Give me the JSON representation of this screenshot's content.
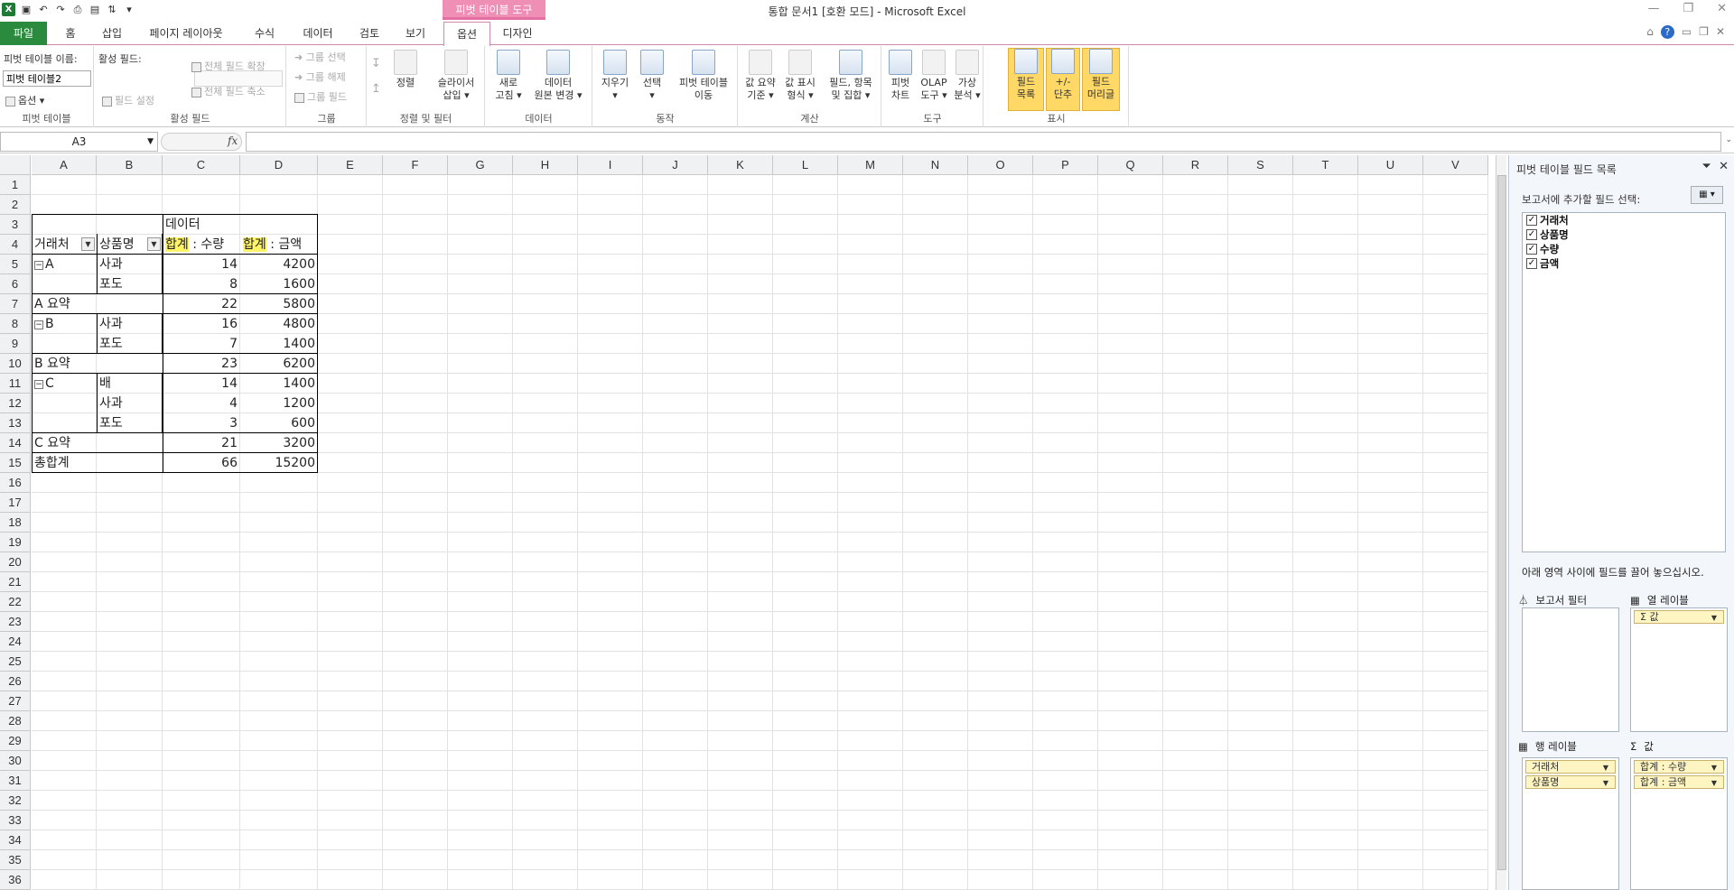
{
  "window": {
    "title": "통합 문서1  [호환 모드]  -  Microsoft Excel",
    "context_tab": "피벗 테이블 도구",
    "controls": [
      "—",
      "❐",
      "✕"
    ]
  },
  "tabs": [
    {
      "label": "파일"
    },
    {
      "label": "홈"
    },
    {
      "label": "삽입"
    },
    {
      "label": "페이지 레이아웃"
    },
    {
      "label": "수식"
    },
    {
      "label": "데이터"
    },
    {
      "label": "검토"
    },
    {
      "label": "보기"
    },
    {
      "label": "옵션"
    },
    {
      "label": "디자인"
    }
  ],
  "ribbon": {
    "pivottable": {
      "name_label": "피벗 테이블 이름:",
      "name_value": "피벗 테이블2",
      "options": "옵션",
      "group": "피벗 테이블"
    },
    "activefield": {
      "label": "활성 필드:",
      "expand": "전체 필드 확장",
      "collapse": "전체 필드 축소",
      "settings": "필드 설정",
      "group": "활성 필드"
    },
    "groupgrp": {
      "select": "그룹 선택",
      "ungroup": "그룹 해제",
      "field": "그룹 필드",
      "group": "그룹"
    },
    "sort": {
      "sort": "정렬",
      "slicer1": "슬라이서",
      "slicer2": "삽입",
      "group": "정렬 및 필터"
    },
    "data": {
      "refresh1": "새로",
      "refresh2": "고침",
      "source1": "데이터",
      "source2": "원본 변경",
      "group": "데이터"
    },
    "actions": {
      "clear": "지우기",
      "select": "선택",
      "move1": "피벗 테이블",
      "move2": "이동",
      "group": "동작"
    },
    "calc": {
      "sum1": "값 요약",
      "sum2": "기준",
      "show1": "값 표시",
      "show2": "형식",
      "fields1": "필드, 항목",
      "fields2": "및 집합",
      "group": "계산"
    },
    "tools": {
      "chart1": "피벗",
      "chart2": "차트",
      "olap1": "OLAP",
      "olap2": "도구",
      "whatif1": "가상",
      "whatif2": "분석",
      "group": "도구"
    },
    "show": {
      "list1": "필드",
      "list2": "목록",
      "btn1": "+/-",
      "btn2": "단추",
      "hdr1": "필드",
      "hdr2": "머리글",
      "group": "표시"
    }
  },
  "formula_bar": {
    "name_box": "A3",
    "fx": "fx",
    "formula": ""
  },
  "columns": [
    "A",
    "B",
    "C",
    "D",
    "E",
    "F",
    "G",
    "H",
    "I",
    "J",
    "K",
    "L",
    "M",
    "N",
    "O",
    "P",
    "Q",
    "R",
    "S",
    "T",
    "U",
    "V"
  ],
  "rows": [
    "1",
    "2",
    "3",
    "4",
    "5",
    "6",
    "7",
    "8",
    "9",
    "10",
    "11",
    "12",
    "13",
    "14",
    "15",
    "16",
    "17",
    "18",
    "19",
    "20",
    "21",
    "22",
    "23",
    "24",
    "25",
    "26",
    "27",
    "28",
    "29",
    "30",
    "31",
    "32",
    "33",
    "34",
    "35",
    "36"
  ],
  "pivot": {
    "data_header": "데이터",
    "hdr_client": "거래처",
    "hdr_product": "상품명",
    "hdr_qty_a": "합계",
    "hdr_qty_b": " : 수량",
    "hdr_amt_a": "합계",
    "hdr_amt_b": " : 금액",
    "rows": [
      {
        "a": "A",
        "b": "사과",
        "c": "14",
        "d": "4200",
        "minus": true
      },
      {
        "a": "",
        "b": "포도",
        "c": "8",
        "d": "1600"
      },
      {
        "a": "A 요약",
        "b": "",
        "c": "22",
        "d": "5800"
      },
      {
        "a": "B",
        "b": "사과",
        "c": "16",
        "d": "4800",
        "minus": true
      },
      {
        "a": "",
        "b": "포도",
        "c": "7",
        "d": "1400"
      },
      {
        "a": "B 요약",
        "b": "",
        "c": "23",
        "d": "6200"
      },
      {
        "a": "C",
        "b": "배",
        "c": "14",
        "d": "1400",
        "minus": true
      },
      {
        "a": "",
        "b": "사과",
        "c": "4",
        "d": "1200"
      },
      {
        "a": "",
        "b": "포도",
        "c": "3",
        "d": "600"
      },
      {
        "a": "C 요약",
        "b": "",
        "c": "21",
        "d": "3200"
      },
      {
        "a": "총합계",
        "b": "",
        "c": "66",
        "d": "15200"
      }
    ]
  },
  "panel": {
    "title": "피벗 테이블 필드 목록",
    "select_label": "보고서에 추가할 필드 선택:",
    "fields": [
      "거래처",
      "상품명",
      "수량",
      "금액"
    ],
    "drag_help": "아래 영역 사이에 필드를 끌어 놓으십시오.",
    "report_filter": "보고서 필터",
    "col_labels": "열 레이블",
    "row_labels": "행 레이블",
    "values": "값",
    "col_items": [
      "Σ 값"
    ],
    "row_items": [
      "거래처",
      "상품명"
    ],
    "value_items": [
      "합계 : 수량",
      "합계 : 금액"
    ]
  }
}
